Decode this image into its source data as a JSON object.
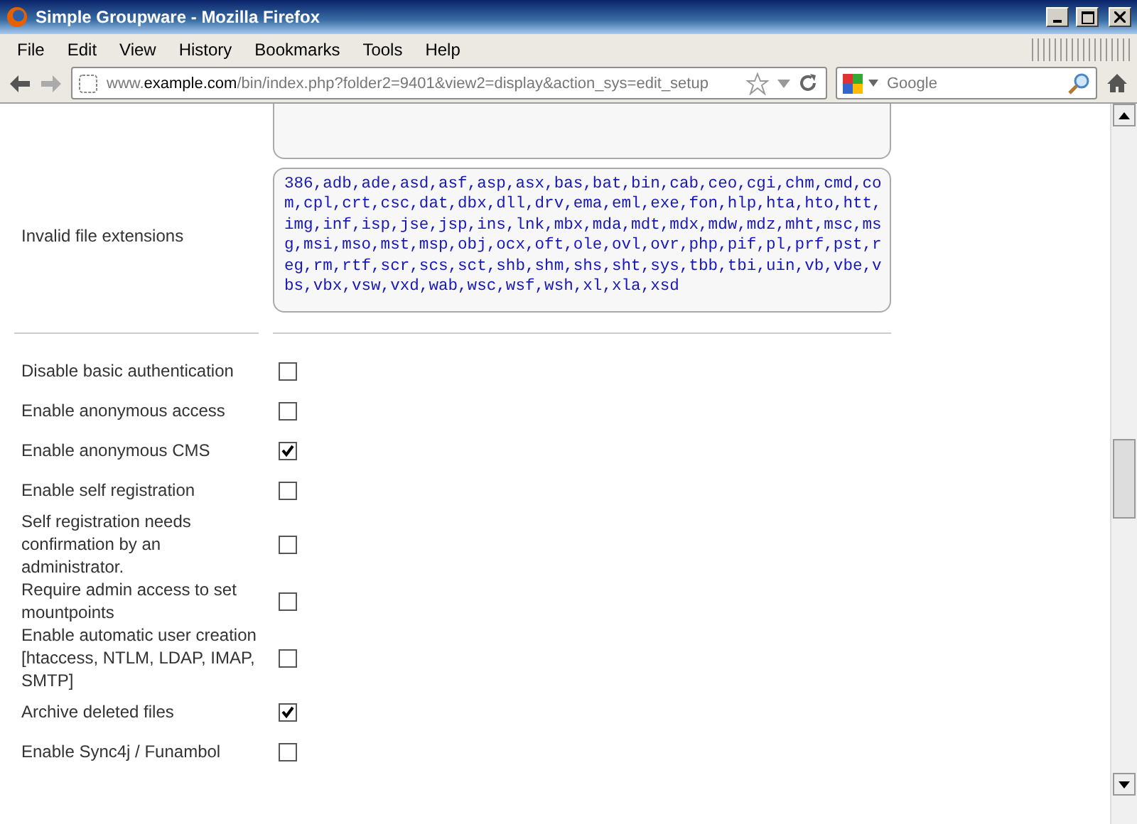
{
  "window": {
    "title": "Simple Groupware - Mozilla Firefox"
  },
  "menu": [
    "File",
    "Edit",
    "View",
    "History",
    "Bookmarks",
    "Tools",
    "Help"
  ],
  "address_bar": {
    "prefix": "www.",
    "domain": "example.com",
    "path": "/bin/index.php?folder2=9401&view2=display&action_sys=edit_setup"
  },
  "search": {
    "placeholder": "Google"
  },
  "file_extensions": {
    "label": "Invalid file extensions",
    "value": "386,adb,ade,asd,asf,asp,asx,bas,bat,bin,cab,ceo,cgi,chm,cmd,com,cpl,crt,csc,dat,dbx,dll,drv,ema,eml,exe,fon,hlp,hta,hto,htt,img,inf,isp,jse,jsp,ins,lnk,mbx,mda,mdt,mdx,mdw,mdz,mht,msc,msg,msi,mso,mst,msp,obj,ocx,oft,ole,ovl,ovr,php,pif,pl,prf,pst,reg,rm,rtf,scr,scs,sct,shb,shm,shs,sht,sys,tbb,tbi,uin,vb,vbe,vbs,vbx,vsw,vxd,wab,wsc,wsf,wsh,xl,xla,xsd"
  },
  "options": [
    {
      "label": "Disable basic authentication",
      "checked": false
    },
    {
      "label": "Enable anonymous access",
      "checked": false
    },
    {
      "label": "Enable anonymous CMS",
      "checked": true
    },
    {
      "label": "Enable self registration",
      "checked": false
    },
    {
      "label": "Self registration needs confirmation by an administrator.",
      "checked": false
    },
    {
      "label": "Require admin access to set mountpoints",
      "checked": false
    },
    {
      "label": "Enable automatic user creation [htaccess, NTLM, LDAP, IMAP, SMTP]",
      "checked": false
    },
    {
      "label": "Archive deleted files",
      "checked": true
    },
    {
      "label": "Enable Sync4j / Funambol",
      "checked": false
    }
  ]
}
